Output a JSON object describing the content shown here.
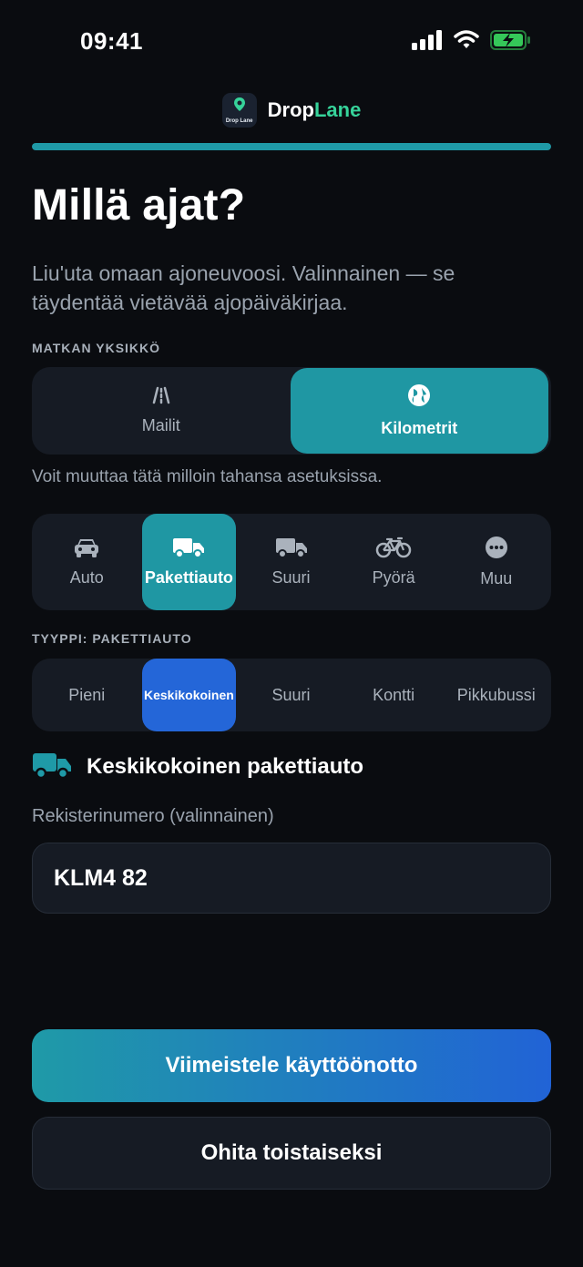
{
  "status_bar": {
    "time": "09:41",
    "icons": [
      "signal-icon",
      "wifi-icon",
      "battery-charging-icon"
    ]
  },
  "brand": {
    "name_part1": "Drop",
    "name_part2": "Lane",
    "logo_text": "Drop Lane",
    "accent_color": "#36d39a"
  },
  "progress": {
    "fraction": 1.0,
    "color": "#1f9aa7"
  },
  "title": "Millä ajat?",
  "subtitle": "Liu'uta omaan ajoneuvoosi. Valinnainen — se täydentää vietävää ajopäiväkirjaa.",
  "distance_unit": {
    "section_label": "MATKAN YKSIKKÖ",
    "options": [
      {
        "label": "Mailit",
        "icon": "road-icon",
        "selected": false
      },
      {
        "label": "Kilometrit",
        "icon": "globe-icon",
        "selected": true
      }
    ],
    "hint": "Voit muuttaa tätä milloin tahansa asetuksissa."
  },
  "vehicle": {
    "options": [
      {
        "label": "Auto",
        "icon": "car-icon",
        "selected": false
      },
      {
        "label": "Pakettiauto",
        "icon": "van-icon",
        "selected": true
      },
      {
        "label": "Suuri",
        "icon": "truck-icon",
        "selected": false
      },
      {
        "label": "Pyörä",
        "icon": "bicycle-icon",
        "selected": false
      },
      {
        "label": "Muu",
        "icon": "more-icon",
        "selected": false
      }
    ]
  },
  "vehicle_type": {
    "section_label": "TYYPPI: PAKETTIAUTO",
    "options": [
      {
        "label": "Pieni",
        "selected": false
      },
      {
        "label": "Keskikokoinen",
        "selected": true
      },
      {
        "label": "Suuri",
        "selected": false
      },
      {
        "label": "Kontti",
        "selected": false
      },
      {
        "label": "Pikkubussi",
        "selected": false
      }
    ]
  },
  "selected_vehicle": {
    "icon": "van-icon",
    "name": "Keskikokoinen pakettiauto",
    "icon_color": "#1f9aa7"
  },
  "registration": {
    "label": "Rekisterinumero (valinnainen)",
    "value": "KLM4 82"
  },
  "actions": {
    "primary_label": "Viimeistele käyttöönotto",
    "secondary_label": "Ohita toistaiseksi"
  },
  "colors": {
    "background": "#0a0c10",
    "teal_accent": "#1f97a3",
    "blue_accent": "#2466d8"
  }
}
